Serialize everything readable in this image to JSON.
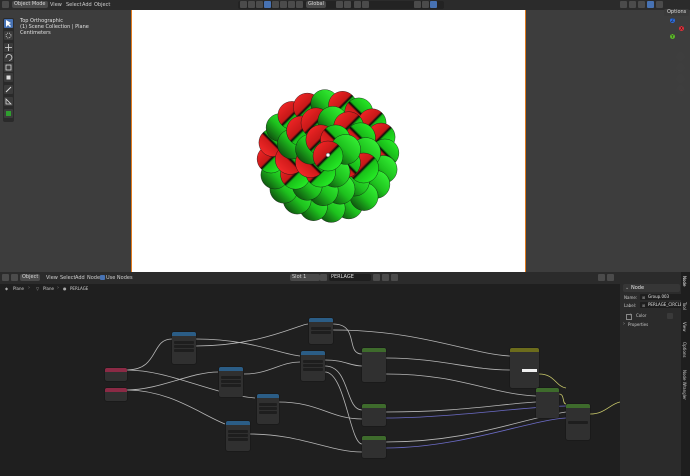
{
  "viewport": {
    "header": {
      "mode_label": "Object Mode",
      "menus": [
        "View",
        "Select",
        "Add",
        "Object"
      ],
      "shading_label": "Global",
      "options_label": "Options"
    },
    "overlay": {
      "line1": "Top Orthographic",
      "line2": "(1) Scene Collection | Plane",
      "line3": "Centimeters"
    },
    "gizmo": {
      "axes": [
        "X",
        "Y",
        "Z"
      ]
    },
    "tools": [
      "select-box",
      "cursor",
      "move",
      "rotate",
      "scale",
      "transform",
      "annotate",
      "measure",
      "add-cube"
    ]
  },
  "node_editor": {
    "header": {
      "editor_type": "Object",
      "menus": [
        "View",
        "Select",
        "Add",
        "Node"
      ],
      "use_nodes_label": "Use Nodes",
      "slot_label": "Slot 1",
      "material_name": "PERLAGE"
    },
    "breadcrumb": {
      "items": [
        "Plane",
        "Plane",
        "PERLAGE"
      ]
    }
  },
  "sidebar": {
    "section_title": "Node",
    "name_label": "Name:",
    "name_value": "Group.003",
    "label_label": "Label:",
    "label_value": "PERLAGE_CIRCLE",
    "color_label": "Color",
    "properties_label": "Properties",
    "tabs": [
      "Node",
      "Tool",
      "View",
      "Options",
      "Node Wrangler"
    ]
  },
  "colors": {
    "accent": "#4772b3",
    "frame": "#e07a1e",
    "sphere_red": "#e01010",
    "sphere_green": "#10e010"
  }
}
